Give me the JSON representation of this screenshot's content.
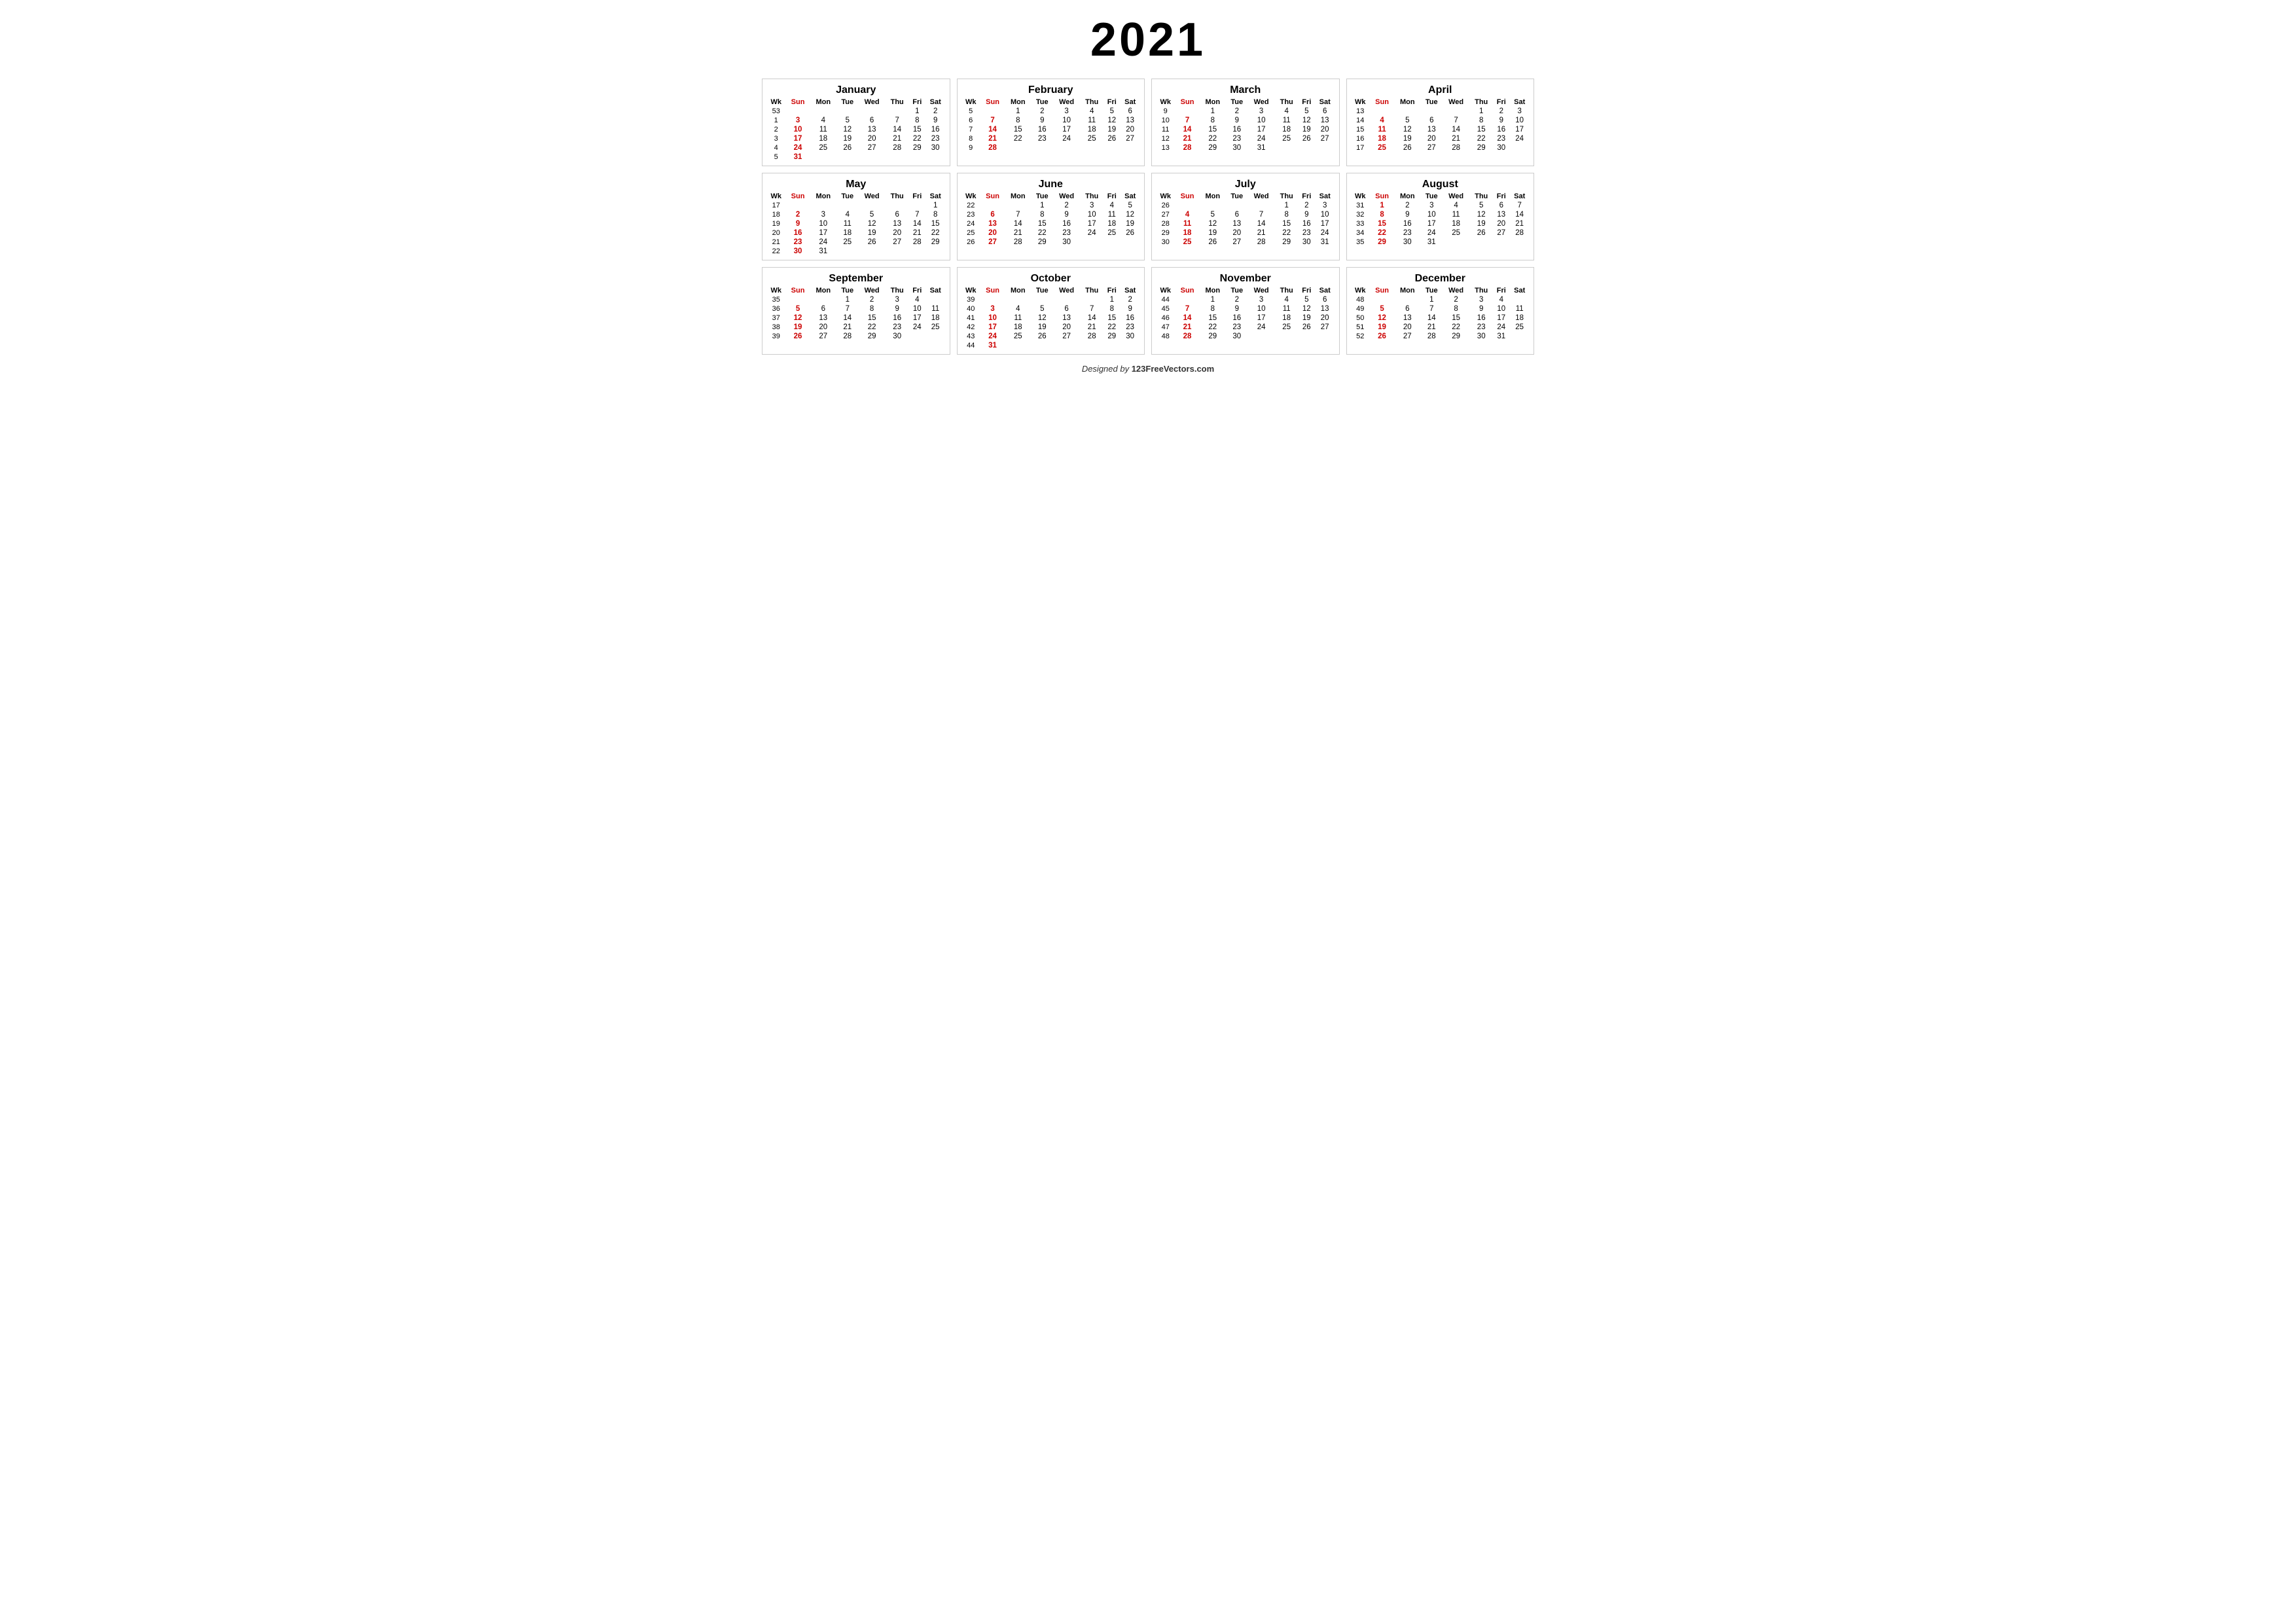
{
  "year": "2021",
  "footer": {
    "prefix": "Designed by ",
    "site": "123FreeVectors.com"
  },
  "months": [
    {
      "name": "January",
      "weeks": [
        {
          "wk": "53",
          "days": [
            "",
            "",
            "",
            "",
            "",
            "1",
            "2"
          ]
        },
        {
          "wk": "1",
          "days": [
            "3",
            "4",
            "5",
            "6",
            "7",
            "8",
            "9"
          ]
        },
        {
          "wk": "2",
          "days": [
            "10",
            "11",
            "12",
            "13",
            "14",
            "15",
            "16"
          ]
        },
        {
          "wk": "3",
          "days": [
            "17",
            "18",
            "19",
            "20",
            "21",
            "22",
            "23"
          ]
        },
        {
          "wk": "4",
          "days": [
            "24",
            "25",
            "26",
            "27",
            "28",
            "29",
            "30"
          ]
        },
        {
          "wk": "5",
          "days": [
            "31",
            "",
            "",
            "",
            "",
            "",
            ""
          ]
        }
      ]
    },
    {
      "name": "February",
      "weeks": [
        {
          "wk": "5",
          "days": [
            "",
            "1",
            "2",
            "3",
            "4",
            "5",
            "6"
          ]
        },
        {
          "wk": "6",
          "days": [
            "7",
            "8",
            "9",
            "10",
            "11",
            "12",
            "13"
          ]
        },
        {
          "wk": "7",
          "days": [
            "14",
            "15",
            "16",
            "17",
            "18",
            "19",
            "20"
          ]
        },
        {
          "wk": "8",
          "days": [
            "21",
            "22",
            "23",
            "24",
            "25",
            "26",
            "27"
          ]
        },
        {
          "wk": "9",
          "days": [
            "28",
            "",
            "",
            "",
            "",
            "",
            ""
          ]
        },
        {
          "wk": "",
          "days": [
            "",
            "",
            "",
            "",
            "",
            "",
            ""
          ]
        }
      ]
    },
    {
      "name": "March",
      "weeks": [
        {
          "wk": "9",
          "days": [
            "",
            "1",
            "2",
            "3",
            "4",
            "5",
            "6"
          ]
        },
        {
          "wk": "10",
          "days": [
            "7",
            "8",
            "9",
            "10",
            "11",
            "12",
            "13"
          ]
        },
        {
          "wk": "11",
          "days": [
            "14",
            "15",
            "16",
            "17",
            "18",
            "19",
            "20"
          ]
        },
        {
          "wk": "12",
          "days": [
            "21",
            "22",
            "23",
            "24",
            "25",
            "26",
            "27"
          ]
        },
        {
          "wk": "13",
          "days": [
            "28",
            "29",
            "30",
            "31",
            "",
            "",
            ""
          ]
        },
        {
          "wk": "",
          "days": [
            "",
            "",
            "",
            "",
            "",
            "",
            ""
          ]
        }
      ]
    },
    {
      "name": "April",
      "weeks": [
        {
          "wk": "13",
          "days": [
            "",
            "",
            "",
            "",
            "1",
            "2",
            "3"
          ]
        },
        {
          "wk": "14",
          "days": [
            "4",
            "5",
            "6",
            "7",
            "8",
            "9",
            "10"
          ]
        },
        {
          "wk": "15",
          "days": [
            "11",
            "12",
            "13",
            "14",
            "15",
            "16",
            "17"
          ]
        },
        {
          "wk": "16",
          "days": [
            "18",
            "19",
            "20",
            "21",
            "22",
            "23",
            "24"
          ]
        },
        {
          "wk": "17",
          "days": [
            "25",
            "26",
            "27",
            "28",
            "29",
            "30",
            ""
          ]
        },
        {
          "wk": "",
          "days": [
            "",
            "",
            "",
            "",
            "",
            "",
            ""
          ]
        }
      ]
    },
    {
      "name": "May",
      "weeks": [
        {
          "wk": "17",
          "days": [
            "",
            "",
            "",
            "",
            "",
            "",
            "1"
          ]
        },
        {
          "wk": "18",
          "days": [
            "2",
            "3",
            "4",
            "5",
            "6",
            "7",
            "8"
          ]
        },
        {
          "wk": "19",
          "days": [
            "9",
            "10",
            "11",
            "12",
            "13",
            "14",
            "15"
          ]
        },
        {
          "wk": "20",
          "days": [
            "16",
            "17",
            "18",
            "19",
            "20",
            "21",
            "22"
          ]
        },
        {
          "wk": "21",
          "days": [
            "23",
            "24",
            "25",
            "26",
            "27",
            "28",
            "29"
          ]
        },
        {
          "wk": "22",
          "days": [
            "30",
            "31",
            "",
            "",
            "",
            "",
            ""
          ]
        }
      ]
    },
    {
      "name": "June",
      "weeks": [
        {
          "wk": "22",
          "days": [
            "",
            "",
            "1",
            "2",
            "3",
            "4",
            "5"
          ]
        },
        {
          "wk": "23",
          "days": [
            "6",
            "7",
            "8",
            "9",
            "10",
            "11",
            "12"
          ]
        },
        {
          "wk": "24",
          "days": [
            "13",
            "14",
            "15",
            "16",
            "17",
            "18",
            "19"
          ]
        },
        {
          "wk": "25",
          "days": [
            "20",
            "21",
            "22",
            "23",
            "24",
            "25",
            "26"
          ]
        },
        {
          "wk": "26",
          "days": [
            "27",
            "28",
            "29",
            "30",
            "",
            "",
            ""
          ]
        },
        {
          "wk": "",
          "days": [
            "",
            "",
            "",
            "",
            "",
            "",
            ""
          ]
        }
      ]
    },
    {
      "name": "July",
      "weeks": [
        {
          "wk": "26",
          "days": [
            "",
            "",
            "",
            "",
            "1",
            "2",
            "3"
          ]
        },
        {
          "wk": "27",
          "days": [
            "4",
            "5",
            "6",
            "7",
            "8",
            "9",
            "10"
          ]
        },
        {
          "wk": "28",
          "days": [
            "11",
            "12",
            "13",
            "14",
            "15",
            "16",
            "17"
          ]
        },
        {
          "wk": "29",
          "days": [
            "18",
            "19",
            "20",
            "21",
            "22",
            "23",
            "24"
          ]
        },
        {
          "wk": "30",
          "days": [
            "25",
            "26",
            "27",
            "28",
            "29",
            "30",
            "31"
          ]
        },
        {
          "wk": "",
          "days": [
            "",
            "",
            "",
            "",
            "",
            "",
            ""
          ]
        }
      ]
    },
    {
      "name": "August",
      "weeks": [
        {
          "wk": "31",
          "days": [
            "1",
            "2",
            "3",
            "4",
            "5",
            "6",
            "7"
          ]
        },
        {
          "wk": "32",
          "days": [
            "8",
            "9",
            "10",
            "11",
            "12",
            "13",
            "14"
          ]
        },
        {
          "wk": "33",
          "days": [
            "15",
            "16",
            "17",
            "18",
            "19",
            "20",
            "21"
          ]
        },
        {
          "wk": "34",
          "days": [
            "22",
            "23",
            "24",
            "25",
            "26",
            "27",
            "28"
          ]
        },
        {
          "wk": "35",
          "days": [
            "29",
            "30",
            "31",
            "",
            "",
            "",
            ""
          ]
        },
        {
          "wk": "",
          "days": [
            "",
            "",
            "",
            "",
            "",
            "",
            ""
          ]
        }
      ]
    },
    {
      "name": "September",
      "weeks": [
        {
          "wk": "35",
          "days": [
            "",
            "",
            "1",
            "2",
            "3",
            "4",
            ""
          ]
        },
        {
          "wk": "36",
          "days": [
            "5",
            "6",
            "7",
            "8",
            "9",
            "10",
            "11"
          ]
        },
        {
          "wk": "37",
          "days": [
            "12",
            "13",
            "14",
            "15",
            "16",
            "17",
            "18"
          ]
        },
        {
          "wk": "38",
          "days": [
            "19",
            "20",
            "21",
            "22",
            "23",
            "24",
            "25"
          ]
        },
        {
          "wk": "39",
          "days": [
            "26",
            "27",
            "28",
            "29",
            "30",
            "",
            ""
          ]
        },
        {
          "wk": "",
          "days": [
            "",
            "",
            "",
            "",
            "",
            "",
            ""
          ]
        }
      ]
    },
    {
      "name": "October",
      "weeks": [
        {
          "wk": "39",
          "days": [
            "",
            "",
            "",
            "",
            "",
            "1",
            "2"
          ]
        },
        {
          "wk": "40",
          "days": [
            "3",
            "4",
            "5",
            "6",
            "7",
            "8",
            "9"
          ]
        },
        {
          "wk": "41",
          "days": [
            "10",
            "11",
            "12",
            "13",
            "14",
            "15",
            "16"
          ]
        },
        {
          "wk": "42",
          "days": [
            "17",
            "18",
            "19",
            "20",
            "21",
            "22",
            "23"
          ]
        },
        {
          "wk": "43",
          "days": [
            "24",
            "25",
            "26",
            "27",
            "28",
            "29",
            "30"
          ]
        },
        {
          "wk": "44",
          "days": [
            "31",
            "",
            "",
            "",
            "",
            "",
            ""
          ]
        }
      ]
    },
    {
      "name": "November",
      "weeks": [
        {
          "wk": "44",
          "days": [
            "",
            "1",
            "2",
            "3",
            "4",
            "5",
            "6"
          ]
        },
        {
          "wk": "45",
          "days": [
            "7",
            "8",
            "9",
            "10",
            "11",
            "12",
            "13"
          ]
        },
        {
          "wk": "46",
          "days": [
            "14",
            "15",
            "16",
            "17",
            "18",
            "19",
            "20"
          ]
        },
        {
          "wk": "47",
          "days": [
            "21",
            "22",
            "23",
            "24",
            "25",
            "26",
            "27"
          ]
        },
        {
          "wk": "48",
          "days": [
            "28",
            "29",
            "30",
            "",
            "",
            "",
            ""
          ]
        },
        {
          "wk": "",
          "days": [
            "",
            "",
            "",
            "",
            "",
            "",
            ""
          ]
        }
      ]
    },
    {
      "name": "December",
      "weeks": [
        {
          "wk": "48",
          "days": [
            "",
            "",
            "1",
            "2",
            "3",
            "4",
            ""
          ]
        },
        {
          "wk": "49",
          "days": [
            "5",
            "6",
            "7",
            "8",
            "9",
            "10",
            "11"
          ]
        },
        {
          "wk": "50",
          "days": [
            "12",
            "13",
            "14",
            "15",
            "16",
            "17",
            "18"
          ]
        },
        {
          "wk": "51",
          "days": [
            "19",
            "20",
            "21",
            "22",
            "23",
            "24",
            "25"
          ]
        },
        {
          "wk": "52",
          "days": [
            "26",
            "27",
            "28",
            "29",
            "30",
            "31",
            ""
          ]
        },
        {
          "wk": "",
          "days": [
            "",
            "",
            "",
            "",
            "",
            "",
            ""
          ]
        }
      ]
    }
  ]
}
